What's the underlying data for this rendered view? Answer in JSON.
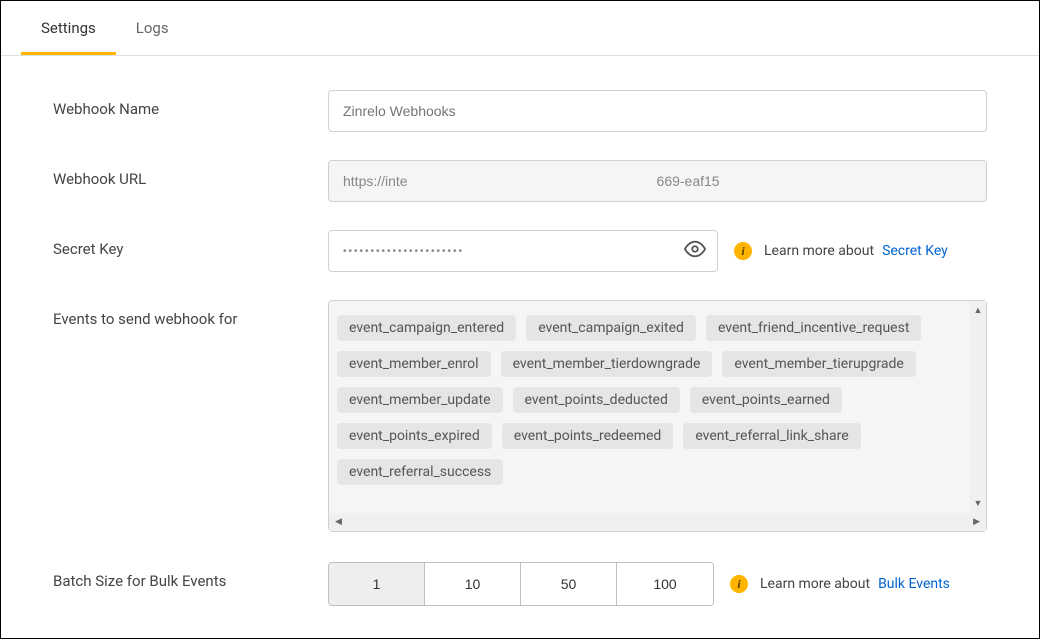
{
  "tabs": {
    "settings": "Settings",
    "logs": "Logs",
    "active": "settings"
  },
  "labels": {
    "webhook_name": "Webhook Name",
    "webhook_url": "Webhook URL",
    "secret_key": "Secret Key",
    "events": "Events to send webhook for",
    "batch": "Batch Size for Bulk Events"
  },
  "name_input": {
    "placeholder": "Zinrelo Webhooks",
    "value": ""
  },
  "url_input": {
    "value": "https://inte                                                                669-eaf15"
  },
  "secret_input": {
    "value": "••••••••••••••••••••••"
  },
  "help": {
    "learn_more": "Learn more about",
    "secret_link": "Secret Key",
    "bulk_link": "Bulk Events"
  },
  "events": [
    "event_campaign_entered",
    "event_campaign_exited",
    "event_friend_incentive_request",
    "event_member_enrol",
    "event_member_tierdowngrade",
    "event_member_tierupgrade",
    "event_member_update",
    "event_points_deducted",
    "event_points_earned",
    "event_points_expired",
    "event_points_redeemed",
    "event_referral_link_share",
    "event_referral_success"
  ],
  "batch_options": [
    "1",
    "10",
    "50",
    "100"
  ],
  "batch_selected": "1"
}
